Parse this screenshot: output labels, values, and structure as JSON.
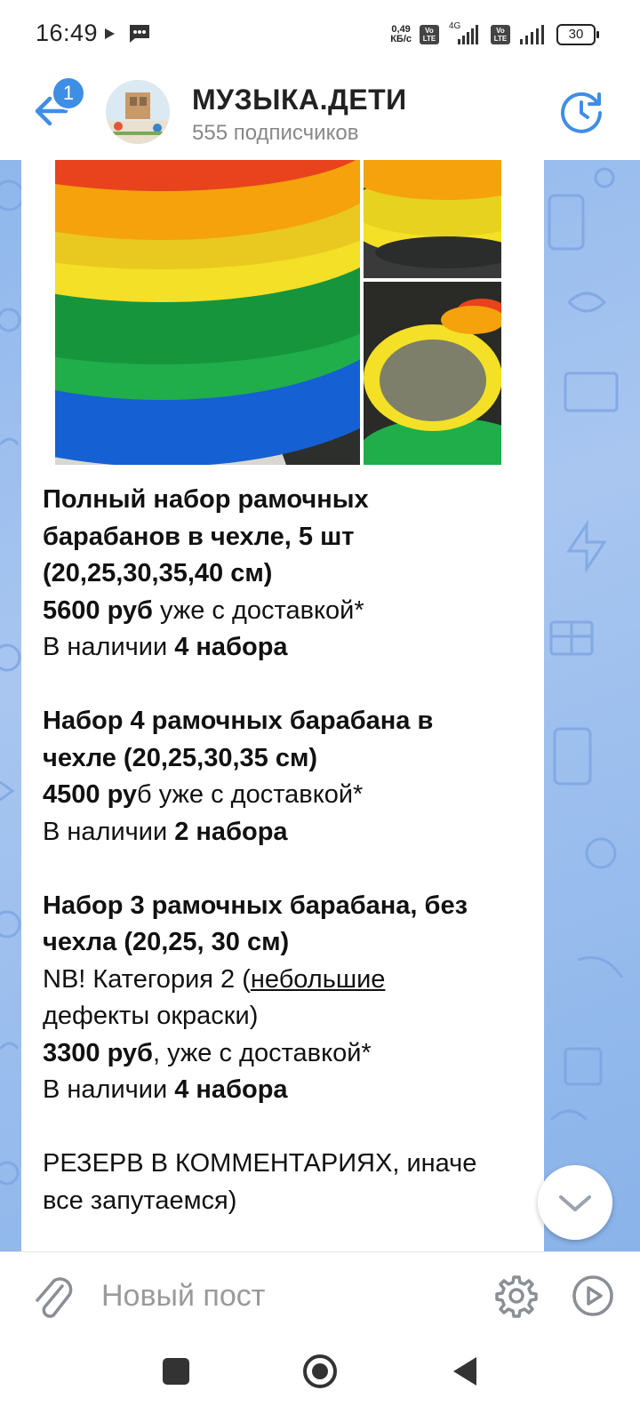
{
  "status_bar": {
    "time": "16:49",
    "net_speed_value": "0,49",
    "net_speed_unit": "КБ/с",
    "volte_label": "Vo LTE",
    "network_type": "4G",
    "battery": "30"
  },
  "header": {
    "unread_badge": "1",
    "channel_name": "МУЗЫКА.ДЕТИ",
    "subscribers": "555 подписчиков"
  },
  "post": {
    "set1_title_l1": "Полный набор рамочных",
    "set1_title_l2": "барабанов в чехле, 5 шт",
    "set1_title_l3": "(20,25,30,35,40 см)",
    "set1_price_bold": "5600 руб",
    "set1_price_rest": " уже  с доставкой*",
    "set1_stock_label": "В наличии ",
    "set1_stock_value": "4 набора",
    "set2_title_l1": "Набор 4 рамочных барабана в",
    "set2_title_l2": "чехле (20,25,30,35 см)",
    "set2_price_bold": "4500 ру",
    "set2_price_rest": "б уже  с доставкой*",
    "set2_stock_label": "В наличии ",
    "set2_stock_value": "2 набора",
    "set3_title_l1": "Набор 3 рамочных барабана, без",
    "set3_title_l2": "чехла (20,25, 30 см)",
    "set3_note_start": "NB! Категория 2 (",
    "set3_note_underlined": "небольшие",
    "set3_note_end": "дефекты окраски)",
    "set3_price_bold": "3300 руб",
    "set3_price_rest": ", уже  с доставкой*",
    "set3_stock_label": "В наличии ",
    "set3_stock_value": "4 набора",
    "reserve_l1": "РЕЗЕРВ В КОММЕНТАРИЯХ, иначе",
    "reserve_l2": "все запутаемся)"
  },
  "composer": {
    "placeholder": "Новый пост"
  },
  "icons": {
    "back": "arrow-left-icon",
    "history": "history-clock-icon",
    "attach": "paperclip-icon",
    "settings": "gear-icon",
    "send": "play-send-icon",
    "scroll": "chevron-down-icon"
  },
  "colors": {
    "accent": "#3f8ee5",
    "chat_bg": "#99bbee",
    "ring_red": "#e8431c",
    "ring_orange": "#f5a20c",
    "ring_yellow": "#f4e026",
    "ring_green": "#1fae4a",
    "ring_blue": "#1560d3"
  }
}
